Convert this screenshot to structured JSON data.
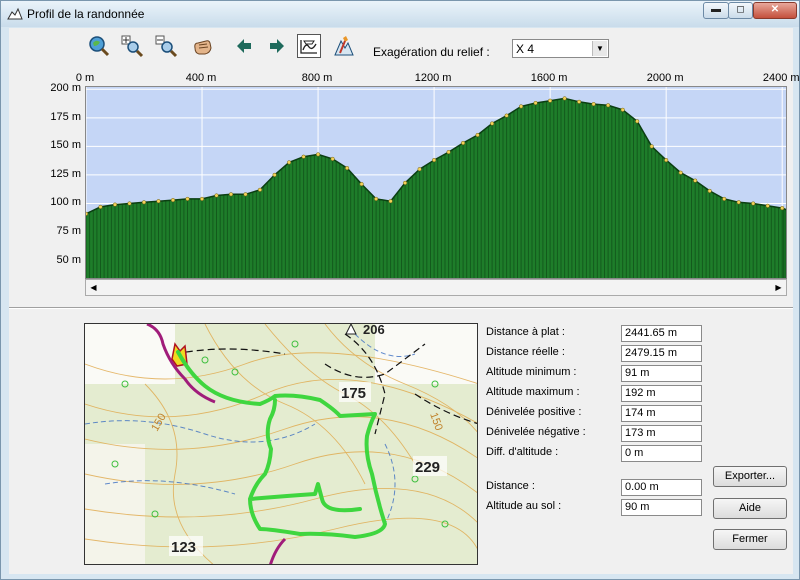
{
  "window": {
    "title": "Profil de la randonnée"
  },
  "toolbar": {
    "relief_label": "Exagération du relief :",
    "relief_value": "X 4",
    "icons": [
      "zoom-fit-icon",
      "zoom-in-icon",
      "zoom-out-icon",
      "pan-hand-icon",
      "arrow-left-icon",
      "arrow-right-icon",
      "profile-view-icon",
      "route-tool-icon"
    ]
  },
  "chart_data": {
    "type": "area",
    "xlabel": "",
    "ylabel": "",
    "x_tick_labels": [
      "0 m",
      "400 m",
      "800 m",
      "1200 m",
      "1600 m",
      "2000 m",
      "2400 m"
    ],
    "x_ticks": [
      0,
      400,
      800,
      1200,
      1600,
      2000,
      2400
    ],
    "y_tick_labels": [
      "200 m",
      "175 m",
      "150 m",
      "125 m",
      "100 m",
      "75 m",
      "50 m"
    ],
    "y_ticks": [
      200,
      175,
      150,
      125,
      100,
      75,
      50
    ],
    "xlim": [
      0,
      2420
    ],
    "ylim": [
      33,
      202
    ],
    "grid": true,
    "colors": {
      "fill": "#1e7d2a",
      "stroke": "#0b3f12",
      "points": "#f2d35a",
      "background": "#c5d6f6",
      "grid": "#ffffff"
    },
    "series": [
      {
        "x": [
          0,
          50,
          100,
          150,
          200,
          250,
          300,
          350,
          400,
          450,
          500,
          550,
          600,
          650,
          700,
          750,
          800,
          850,
          900,
          950,
          1000,
          1050,
          1100,
          1150,
          1200,
          1250,
          1300,
          1350,
          1400,
          1450,
          1500,
          1550,
          1600,
          1650,
          1700,
          1750,
          1800,
          1850,
          1900,
          1950,
          2000,
          2050,
          2100,
          2150,
          2200,
          2250,
          2300,
          2350,
          2400,
          2420
        ],
        "y": [
          91,
          97,
          99,
          100,
          101,
          102,
          103,
          104,
          104,
          107,
          108,
          108,
          112,
          125,
          136,
          141,
          143,
          139,
          131,
          117,
          104,
          102,
          118,
          130,
          138,
          145,
          153,
          160,
          170,
          177,
          185,
          188,
          190,
          192,
          189,
          187,
          186,
          182,
          172,
          150,
          138,
          127,
          120,
          111,
          104,
          101,
          100,
          98,
          96,
          94
        ]
      }
    ]
  },
  "stats": [
    {
      "label": "Distance à plat :",
      "value": "2441.65 m"
    },
    {
      "label": "Distance réelle :",
      "value": "2479.15 m"
    },
    {
      "label": "Altitude minimum :",
      "value": "91 m"
    },
    {
      "label": "Altitude maximum :",
      "value": "192 m"
    },
    {
      "label": "Dénivelée positive :",
      "value": "174 m"
    },
    {
      "label": "Dénivelée négative :",
      "value": "173 m"
    },
    {
      "label": "Diff. d'altitude :",
      "value": "0 m"
    }
  ],
  "cursor": [
    {
      "label": "Distance :",
      "value": "0.00 m"
    },
    {
      "label": "Altitude au sol :",
      "value": "90 m"
    }
  ],
  "map": {
    "labels": [
      "206",
      "175",
      "229",
      "150",
      "150",
      "123"
    ]
  },
  "buttons": {
    "export": "Exporter...",
    "help": "Aide",
    "close": "Fermer"
  }
}
